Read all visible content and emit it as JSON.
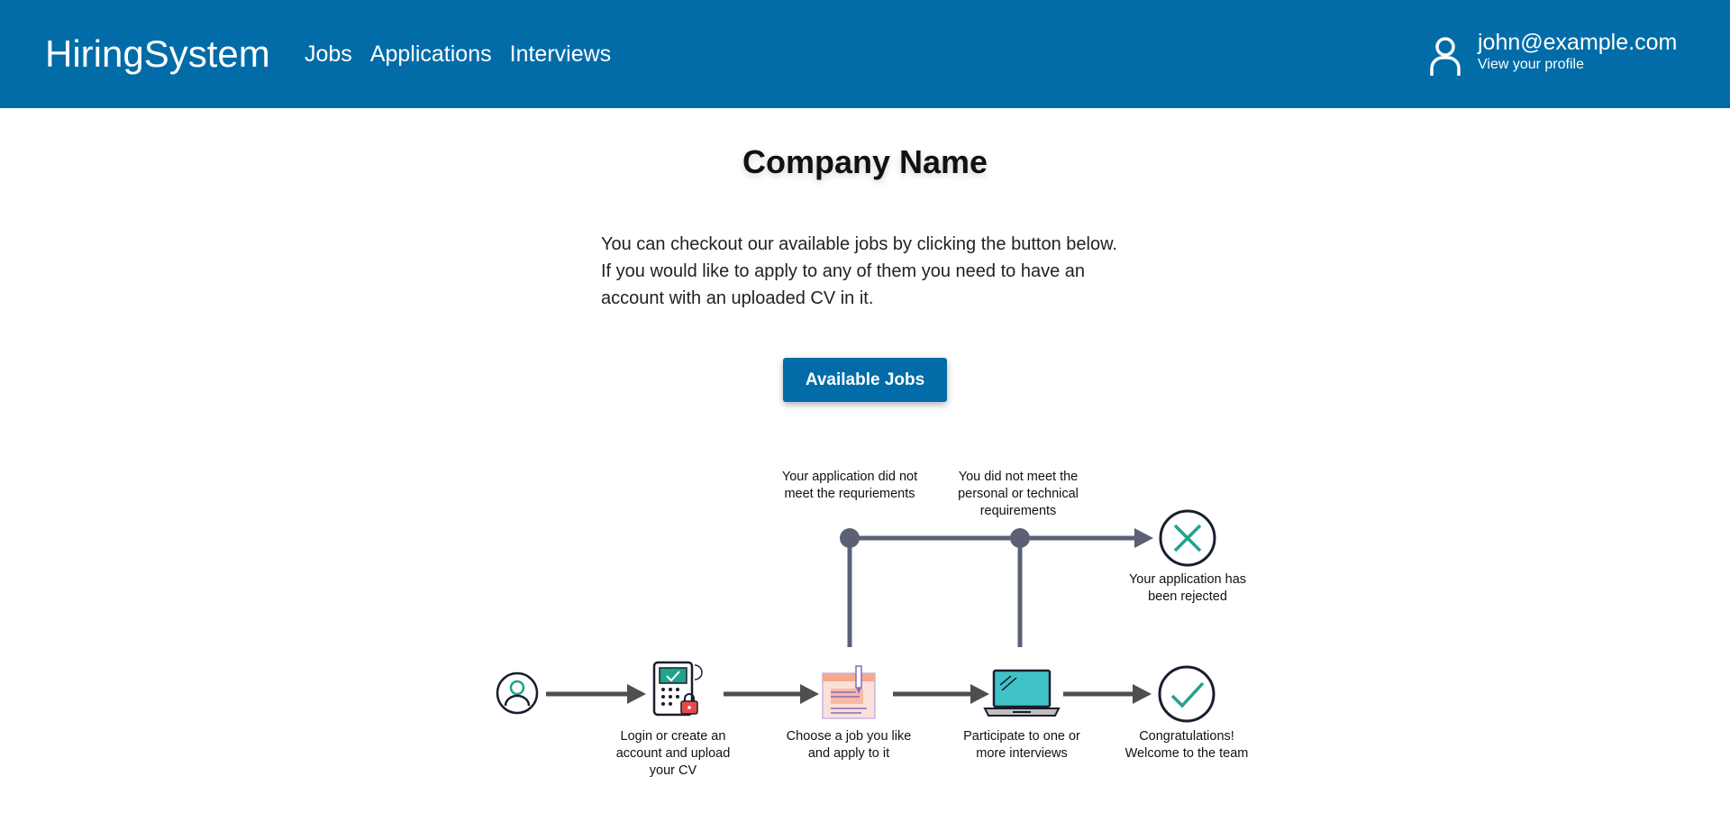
{
  "nav": {
    "brand": "HiringSystem",
    "links": [
      "Jobs",
      "Applications",
      "Interviews"
    ],
    "profile": {
      "email": "john@example.com",
      "subtitle": "View your profile",
      "icon": "user-icon"
    }
  },
  "main": {
    "company_name": "Company Name",
    "intro": "You can checkout our available jobs by clicking the button below. If you would like to apply to any of them you need to have an account with an uploaded CV in it.",
    "button_label": "Available Jobs"
  },
  "flow": {
    "fail_labels": [
      "Your application did not meet the requriements",
      "You did not meet the personal or technical requirements"
    ],
    "rejected_label": "Your application has been rejected",
    "steps": [
      {
        "icon": "user-icon",
        "label": ""
      },
      {
        "icon": "keypad-lock-icon",
        "label": "Login or create an account and upload your CV"
      },
      {
        "icon": "job-form-icon",
        "label": "Choose a job you like and apply to it"
      },
      {
        "icon": "laptop-icon",
        "label": "Participate to one or more interviews"
      },
      {
        "icon": "check-circle-icon",
        "label": "Congratulations! Welcome to the team"
      }
    ],
    "colors": {
      "teal": "#21a38b",
      "line": "#5c6075",
      "arrow": "#4f4f4f",
      "brand": "#016ca8"
    }
  }
}
